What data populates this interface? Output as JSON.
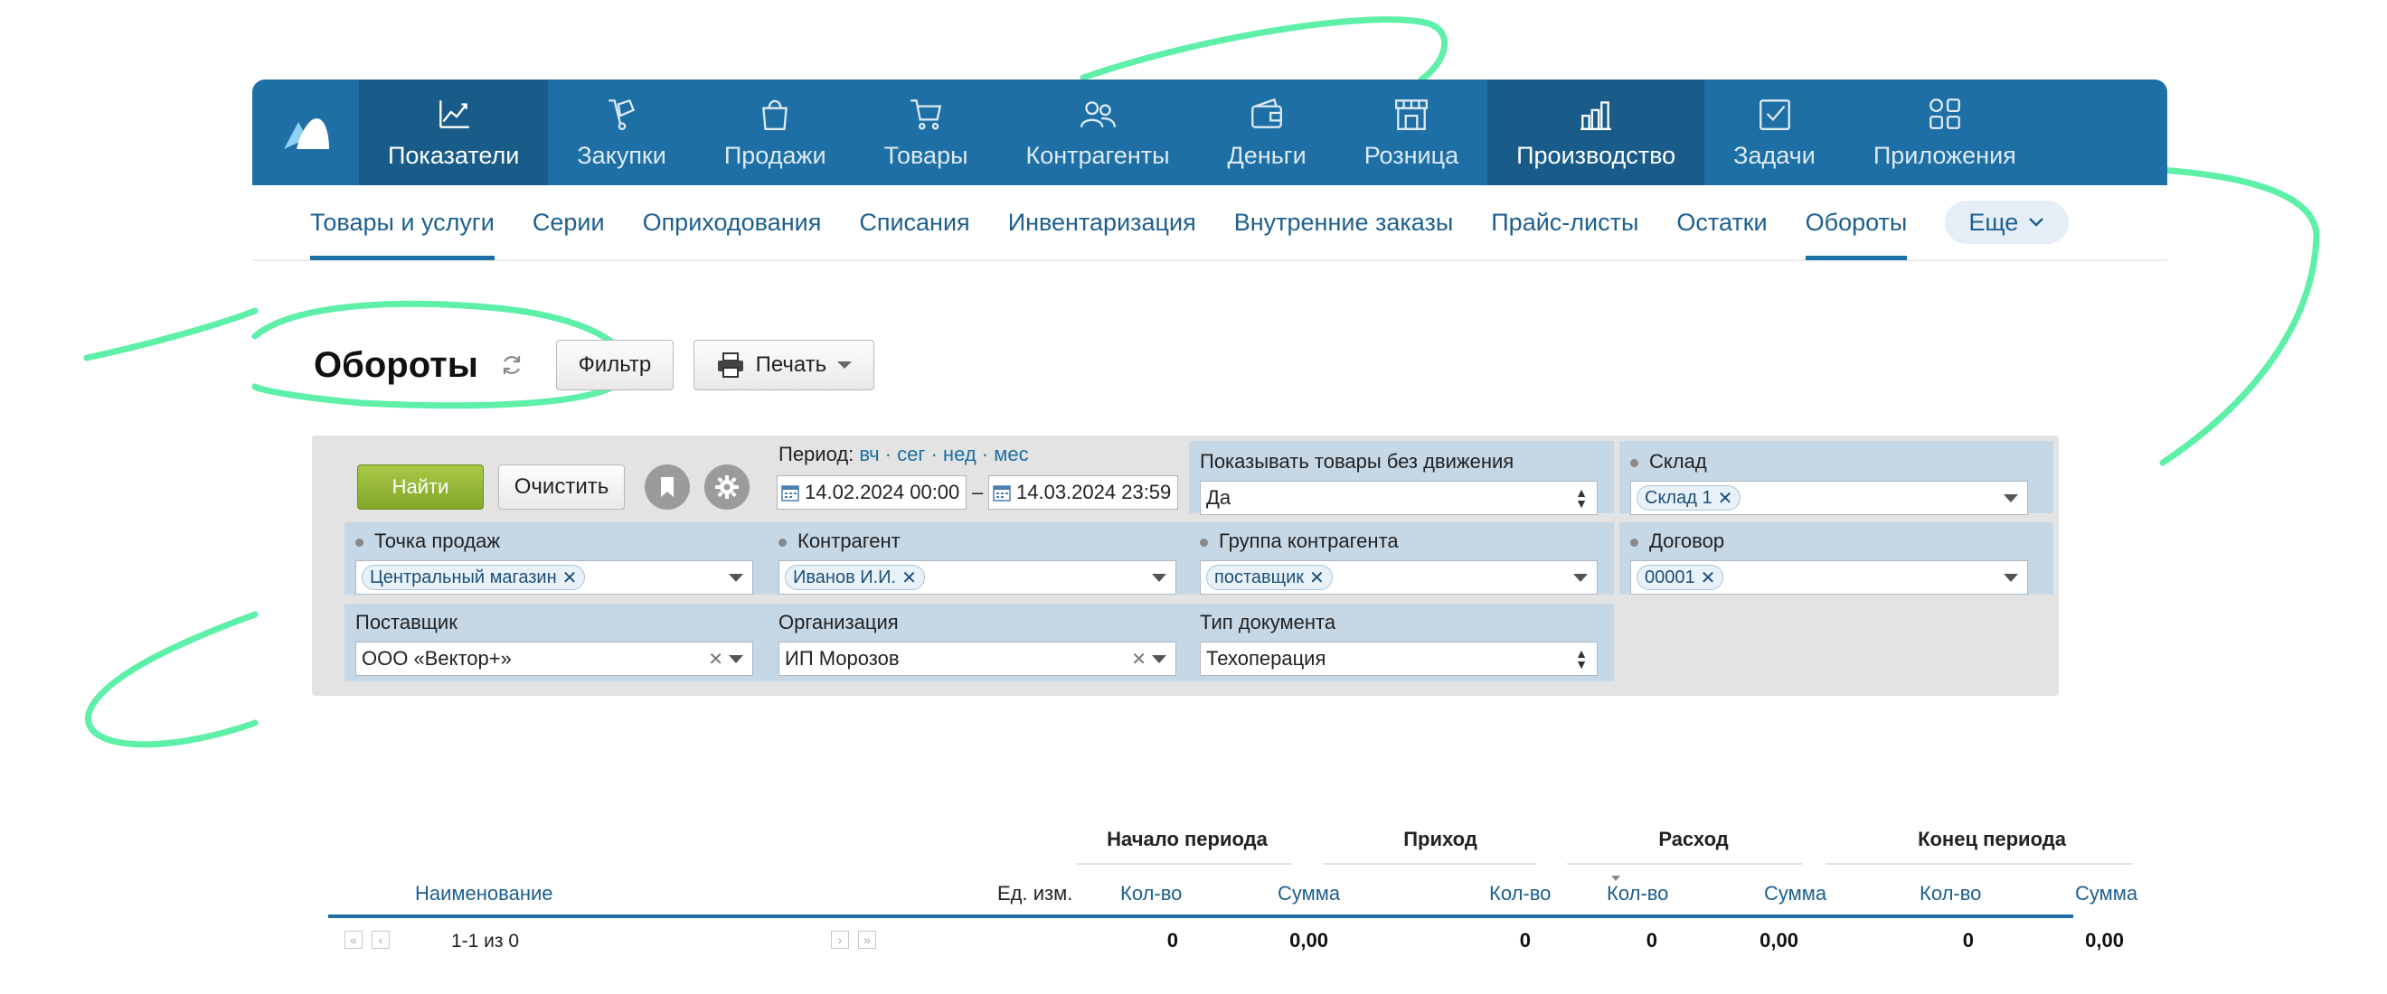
{
  "topnav": {
    "items": [
      {
        "label": "Показатели",
        "icon": "chart-line-icon",
        "active": true
      },
      {
        "label": "Закупки",
        "icon": "hand-truck-icon"
      },
      {
        "label": "Продажи",
        "icon": "shopping-bag-icon"
      },
      {
        "label": "Товары",
        "icon": "cart-icon"
      },
      {
        "label": "Контрагенты",
        "icon": "users-icon"
      },
      {
        "label": "Деньги",
        "icon": "wallet-icon"
      },
      {
        "label": "Розница",
        "icon": "store-icon"
      },
      {
        "label": "Производство",
        "icon": "factory-icon",
        "active": true
      },
      {
        "label": "Задачи",
        "icon": "task-check-icon"
      },
      {
        "label": "Приложения",
        "icon": "apps-grid-icon"
      }
    ]
  },
  "subnav": {
    "items": [
      {
        "label": "Товары и услуги",
        "active": true
      },
      {
        "label": "Серии"
      },
      {
        "label": "Оприходования"
      },
      {
        "label": "Списания"
      },
      {
        "label": "Инвентаризация"
      },
      {
        "label": "Внутренние заказы"
      },
      {
        "label": "Прайс-листы"
      },
      {
        "label": "Остатки"
      },
      {
        "label": "Обороты",
        "active": true
      }
    ],
    "more_label": "Еще"
  },
  "page": {
    "title": "Обороты",
    "filter_label": "Фильтр",
    "print_label": "Печать"
  },
  "filters": {
    "find_label": "Найти",
    "clear_label": "Очистить",
    "period_label": "Период:",
    "period_links": "вч · сег · нед · мес",
    "date_from": "14.02.2024 00:00",
    "date_sep": "–",
    "date_to": "14.03.2024 23:59",
    "show_no_movement_label": "Показывать товары без движения",
    "show_no_movement_value": "Да",
    "warehouse_label": "Склад",
    "warehouse_value": "Склад 1",
    "point_of_sale_label": "Точка продаж",
    "point_of_sale_value": "Центральный магазин",
    "counterparty_label": "Контрагент",
    "counterparty_value": "Иванов И.И.",
    "counterparty_group_label": "Группа контрагента",
    "counterparty_group_value": "поставщик",
    "contract_label": "Договор",
    "contract_value": "00001",
    "supplier_label": "Поставщик",
    "supplier_value": "ООО «Вектор+»",
    "organization_label": "Организация",
    "organization_value": "ИП Морозов",
    "doc_type_label": "Тип документа",
    "doc_type_value": "Техоперация"
  },
  "table": {
    "groups": {
      "start": "Начало периода",
      "income": "Приход",
      "expense": "Расход",
      "end": "Конец периода"
    },
    "columns": {
      "name": "Наименование",
      "unit": "Ед. изм.",
      "start_qty": "Кол-во",
      "start_sum": "Сумма",
      "income_qty": "Кол-во",
      "expense_qty": "Кол-во",
      "expense_sum": "Сумма",
      "end_qty": "Кол-во",
      "end_sum": "Сумма"
    },
    "pager": "1-1 из 0",
    "totals": {
      "start_qty": "0",
      "start_sum": "0,00",
      "income_qty": "0",
      "expense_qty": "0",
      "expense_sum": "0,00",
      "end_qty": "0",
      "end_sum": "0,00"
    }
  },
  "colors": {
    "nav_bg": "#1d6fa5",
    "nav_active": "#195c8a",
    "accent_green": "#5ef0a8",
    "find_button": "#9bbd3a"
  }
}
